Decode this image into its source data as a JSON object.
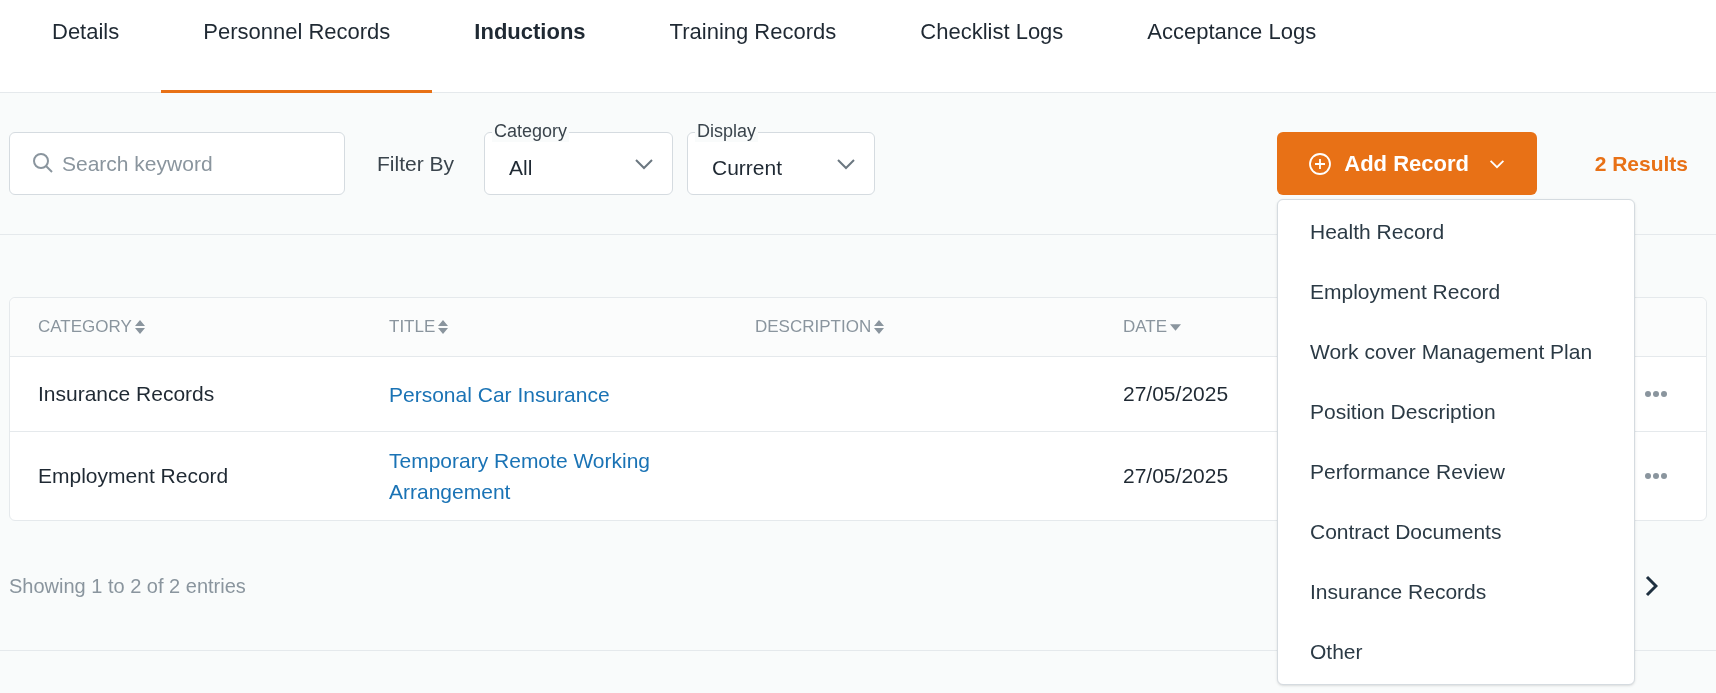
{
  "tabs": [
    {
      "label": "Details",
      "selected": false,
      "emphasized": false
    },
    {
      "label": "Personnel Records",
      "selected": true,
      "emphasized": false
    },
    {
      "label": "Inductions",
      "selected": false,
      "emphasized": true
    },
    {
      "label": "Training Records",
      "selected": false,
      "emphasized": false
    },
    {
      "label": "Checklist Logs",
      "selected": false,
      "emphasized": false
    },
    {
      "label": "Acceptance Logs",
      "selected": false,
      "emphasized": false
    }
  ],
  "toolbar": {
    "search": {
      "placeholder": "Search keyword"
    },
    "filter_label": "Filter By",
    "filters": [
      {
        "label": "Category",
        "value": "All"
      },
      {
        "label": "Display",
        "value": "Current"
      }
    ],
    "add_button": {
      "label": "Add Record",
      "expanded": true
    },
    "results": "2 Results"
  },
  "add_menu": [
    "Health Record",
    "Employment Record",
    "Work cover Management Plan",
    "Position Description",
    "Performance Review",
    "Contract Documents",
    "Insurance Records",
    "Other"
  ],
  "table": {
    "columns": [
      {
        "label": "CATEGORY",
        "sorted": false
      },
      {
        "label": "TITLE",
        "sorted": false
      },
      {
        "label": "DESCRIPTION",
        "sorted": false
      },
      {
        "label": "DATE",
        "sorted": true
      }
    ],
    "rows": [
      {
        "category": "Insurance Records",
        "title": "Personal Car Insurance",
        "date": "27/05/2025"
      },
      {
        "category": "Employment Record",
        "title": "Temporary Remote Working Arrangement",
        "date": "27/05/2025"
      }
    ]
  },
  "footer": {
    "summary": "Showing 1 to 2 of 2 entries"
  }
}
